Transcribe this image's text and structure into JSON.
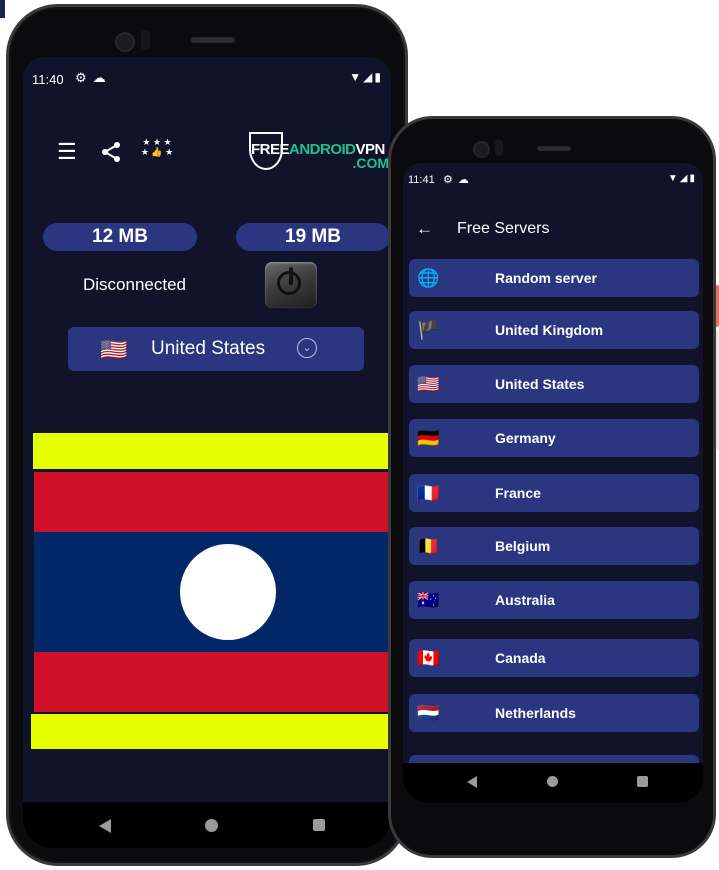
{
  "left_phone": {
    "status_bar": {
      "time": "11:40",
      "left_icons": [
        "gear-icon",
        "cloud-icon"
      ],
      "right_icons": [
        "wifi-icon",
        "signal-icon",
        "battery-icon"
      ]
    },
    "toolbar": {
      "icons": [
        "list-icon",
        "share-icon",
        "rate-stars-thumb-icon"
      ]
    },
    "logo": {
      "part1": "FREE",
      "part2": "ANDROID",
      "part3": "VPN",
      "line2": ".COM"
    },
    "stats": {
      "download": "12 MB",
      "upload": "19 MB"
    },
    "connection_status": "Disconnected",
    "selected_country": {
      "flag": "🇺🇸",
      "name": "United States"
    },
    "flag_display": {
      "country": "Laos",
      "colors": {
        "yellow": "#e6ff00",
        "red": "#ce1126",
        "blue": "#002868",
        "white": "#ffffff"
      }
    },
    "nav_bar": [
      "back",
      "home",
      "recents"
    ]
  },
  "right_phone": {
    "status_bar": {
      "time": "11:41",
      "left_icons": [
        "gear-icon",
        "cloud-icon"
      ],
      "right_icons": [
        "wifi-icon",
        "signal-icon",
        "battery-icon"
      ]
    },
    "header": {
      "back_glyph": "←",
      "title": "Free Servers"
    },
    "servers": [
      {
        "flag": "🌐",
        "name": "Random server"
      },
      {
        "flag": "🏴",
        "name": "United Kingdom"
      },
      {
        "flag": "🇺🇸",
        "name": "United States"
      },
      {
        "flag": "🇩🇪",
        "name": "Germany"
      },
      {
        "flag": "🇫🇷",
        "name": "France"
      },
      {
        "flag": "🇧🇪",
        "name": "Belgium"
      },
      {
        "flag": "🇦🇺",
        "name": "Australia"
      },
      {
        "flag": "🇨🇦",
        "name": "Canada"
      },
      {
        "flag": "🇳🇱",
        "name": "Netherlands"
      },
      {
        "flag": "",
        "name": ""
      }
    ],
    "nav_bar": [
      "back",
      "home",
      "recents"
    ]
  },
  "colors": {
    "background": "#11132a",
    "accent": "#2b3680",
    "logo_green": "#20c08f"
  }
}
